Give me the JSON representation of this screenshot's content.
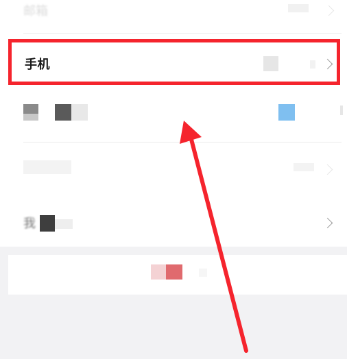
{
  "settings_list": {
    "top_item": {
      "label": "邮箱"
    },
    "phone_item": {
      "label": "手机"
    },
    "item_3": {
      "label": ""
    },
    "item_4": {
      "label": ""
    },
    "item_5": {
      "label": "我"
    }
  },
  "colors": {
    "highlight": "#f5242d",
    "arrow": "#f5242d",
    "background_band": "#f2f2f4",
    "accent_blue": "#7fbff0"
  },
  "icons": {
    "chevron": "chevron-right-icon"
  }
}
